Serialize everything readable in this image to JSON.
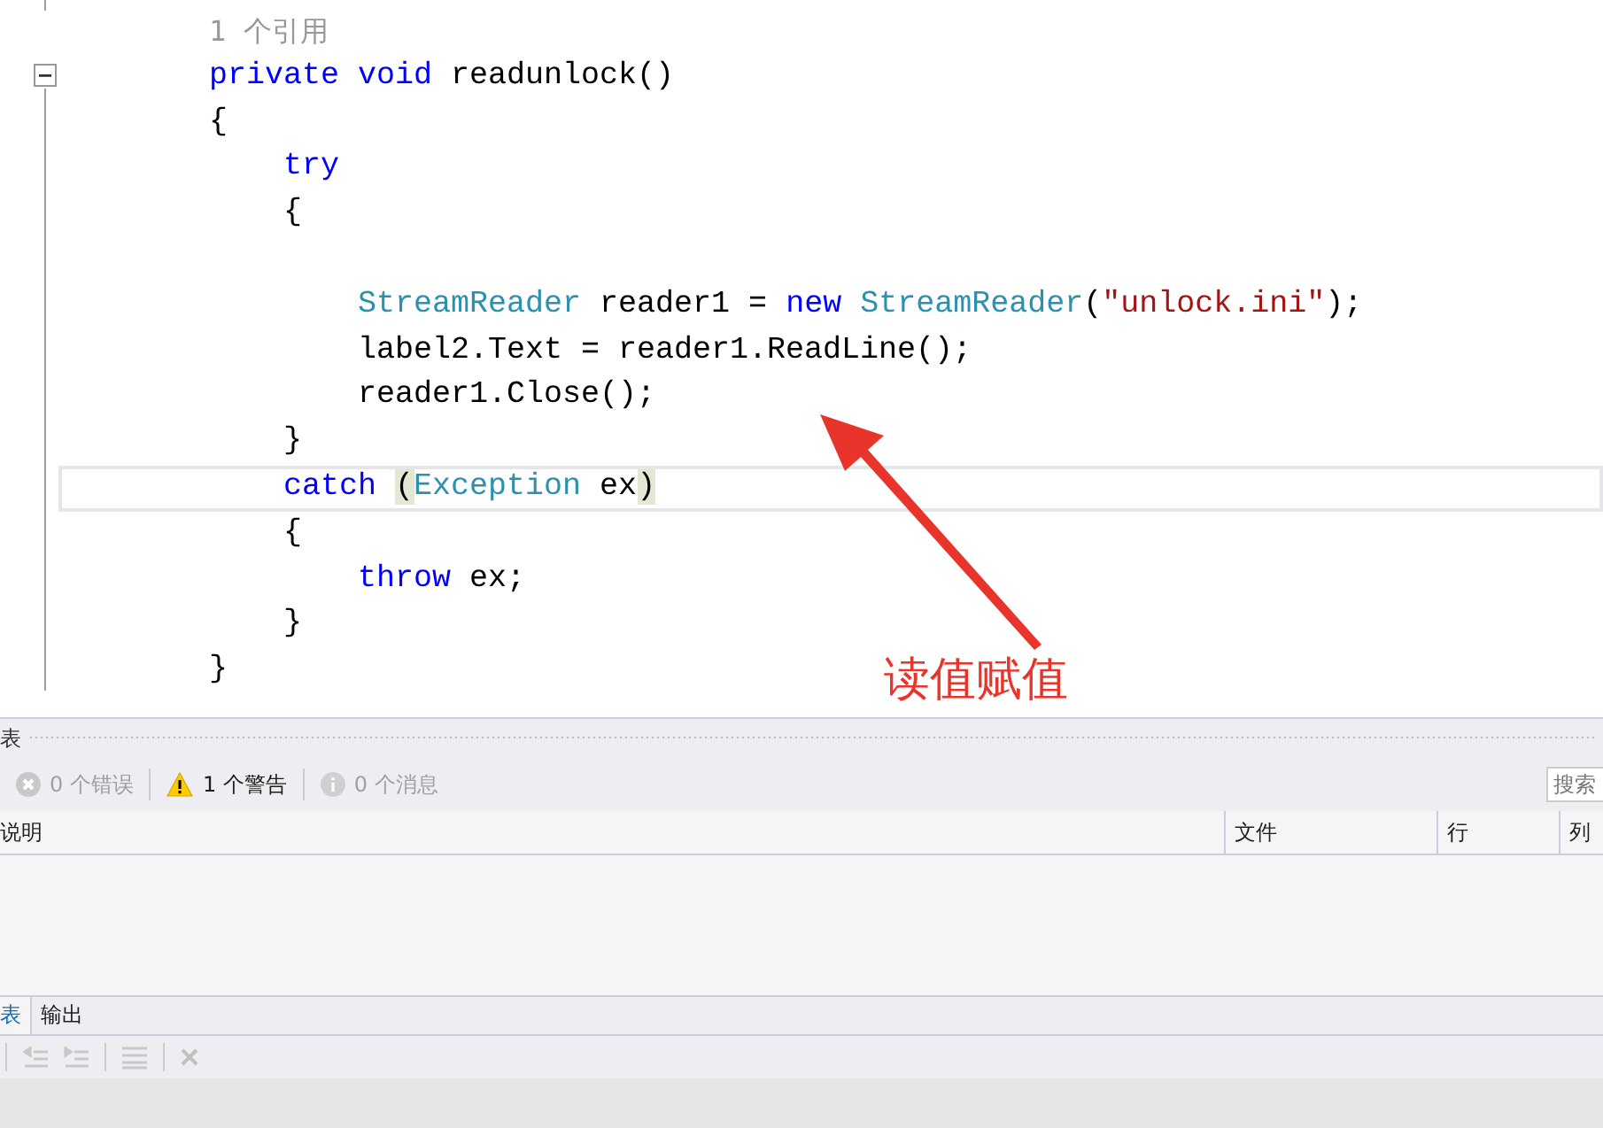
{
  "editor": {
    "reference_hint": "1 个引用",
    "lines": [
      {
        "current": false,
        "tokens": [
          {
            "kind": "keyword",
            "text": "private"
          },
          {
            "kind": "keyword",
            "text": " void"
          },
          {
            "kind": "plain",
            "text": " readunlock()"
          }
        ]
      },
      {
        "current": false,
        "tokens": [
          {
            "kind": "brace",
            "text": "{"
          }
        ]
      },
      {
        "current": false,
        "tokens": [
          {
            "kind": "keyword",
            "text": "    try"
          }
        ]
      },
      {
        "current": false,
        "tokens": [
          {
            "kind": "brace",
            "text": "    {"
          }
        ]
      },
      {
        "current": false
      },
      {
        "current": false,
        "tokens": [
          {
            "kind": "type",
            "text": "        StreamReader"
          },
          {
            "kind": "plain",
            "text": " reader1 = "
          },
          {
            "kind": "keyword",
            "text": "new"
          },
          {
            "kind": "type",
            "text": " StreamReader"
          },
          {
            "kind": "plain",
            "text": "("
          },
          {
            "kind": "string",
            "text": "\"unlock.ini\""
          },
          {
            "kind": "plain",
            "text": ");"
          }
        ]
      },
      {
        "current": false,
        "tokens": [
          {
            "kind": "plain",
            "text": "        label2.Text = reader1.ReadLine();"
          }
        ]
      },
      {
        "current": false,
        "tokens": [
          {
            "kind": "plain",
            "text": "        reader1.Close();"
          }
        ]
      },
      {
        "current": false,
        "tokens": [
          {
            "kind": "brace",
            "text": "    }"
          }
        ]
      },
      {
        "current": true,
        "tokens": [
          {
            "kind": "keyword",
            "text": "    catch "
          },
          {
            "kind": "match",
            "text": "("
          },
          {
            "kind": "type",
            "text": "Exception"
          },
          {
            "kind": "plain",
            "text": " ex"
          },
          {
            "kind": "match",
            "text": ")"
          }
        ]
      },
      {
        "current": false,
        "tokens": [
          {
            "kind": "brace",
            "text": "    {"
          }
        ]
      },
      {
        "current": false,
        "tokens": [
          {
            "kind": "keyword",
            "text": "        throw"
          },
          {
            "kind": "plain",
            "text": " ex;"
          }
        ]
      },
      {
        "current": false,
        "tokens": [
          {
            "kind": "brace",
            "text": "    }"
          }
        ]
      },
      {
        "current": false,
        "tokens": [
          {
            "kind": "brace",
            "text": "}"
          }
        ]
      }
    ],
    "annotation": "读值赋值"
  },
  "error_list": {
    "title": "表",
    "filters": [
      {
        "kind": "error",
        "label": "0 个错误",
        "selected": false
      },
      {
        "kind": "warning",
        "label": "1 个警告",
        "selected": true
      },
      {
        "kind": "info",
        "label": "0 个消息",
        "selected": false
      }
    ],
    "search": {
      "placeholder": "搜索"
    },
    "columns": [
      "说明",
      "文件",
      "行",
      "列"
    ]
  },
  "tabs": [
    {
      "label": "表",
      "selected": true
    },
    {
      "label": "输出",
      "selected": false
    }
  ]
}
